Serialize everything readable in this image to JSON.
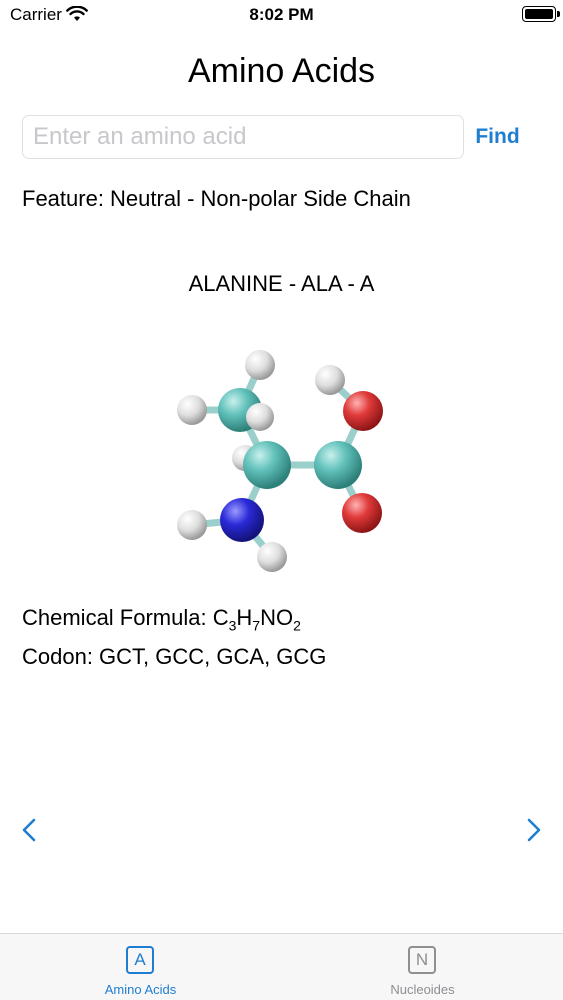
{
  "status_bar": {
    "carrier": "Carrier",
    "time": "8:02 PM",
    "battery_level": 1.0,
    "icons": [
      "wifi-icon",
      "battery-icon"
    ]
  },
  "header": {
    "title": "Amino Acids"
  },
  "search": {
    "placeholder": "Enter an amino acid",
    "value": "",
    "button_label": "Find"
  },
  "feature": "Feature: Neutral - Non-polar Side Chain",
  "amino_acid": {
    "heading": "ALANINE - ALA - A",
    "formula_label": "Chemical Formula: ",
    "formula_parts": [
      {
        "text": "C",
        "sub": "3"
      },
      {
        "text": "H",
        "sub": "7"
      },
      {
        "text": "NO",
        "sub": "2"
      }
    ],
    "codon_line": "Codon: GCT, GCC, GCA, GCG"
  },
  "molecule": {
    "description_icon": "alanine-ball-and-stick-model",
    "atom_colors": {
      "carbon": "#62c1bb",
      "hydrogen": "#e8e8e8",
      "oxygen": "#e03a3a",
      "nitrogen": "#2a2ad8"
    }
  },
  "navigation": {
    "prev_icon": "chevron-left-icon",
    "next_icon": "chevron-right-icon"
  },
  "tab_bar": {
    "active_color": "#1f7ed0",
    "inactive_color": "#8e8e93",
    "tabs": [
      {
        "label": "Amino Acids",
        "icon_letter": "A",
        "active": true
      },
      {
        "label": "Nucleoides",
        "icon_letter": "N",
        "active": false
      }
    ]
  }
}
